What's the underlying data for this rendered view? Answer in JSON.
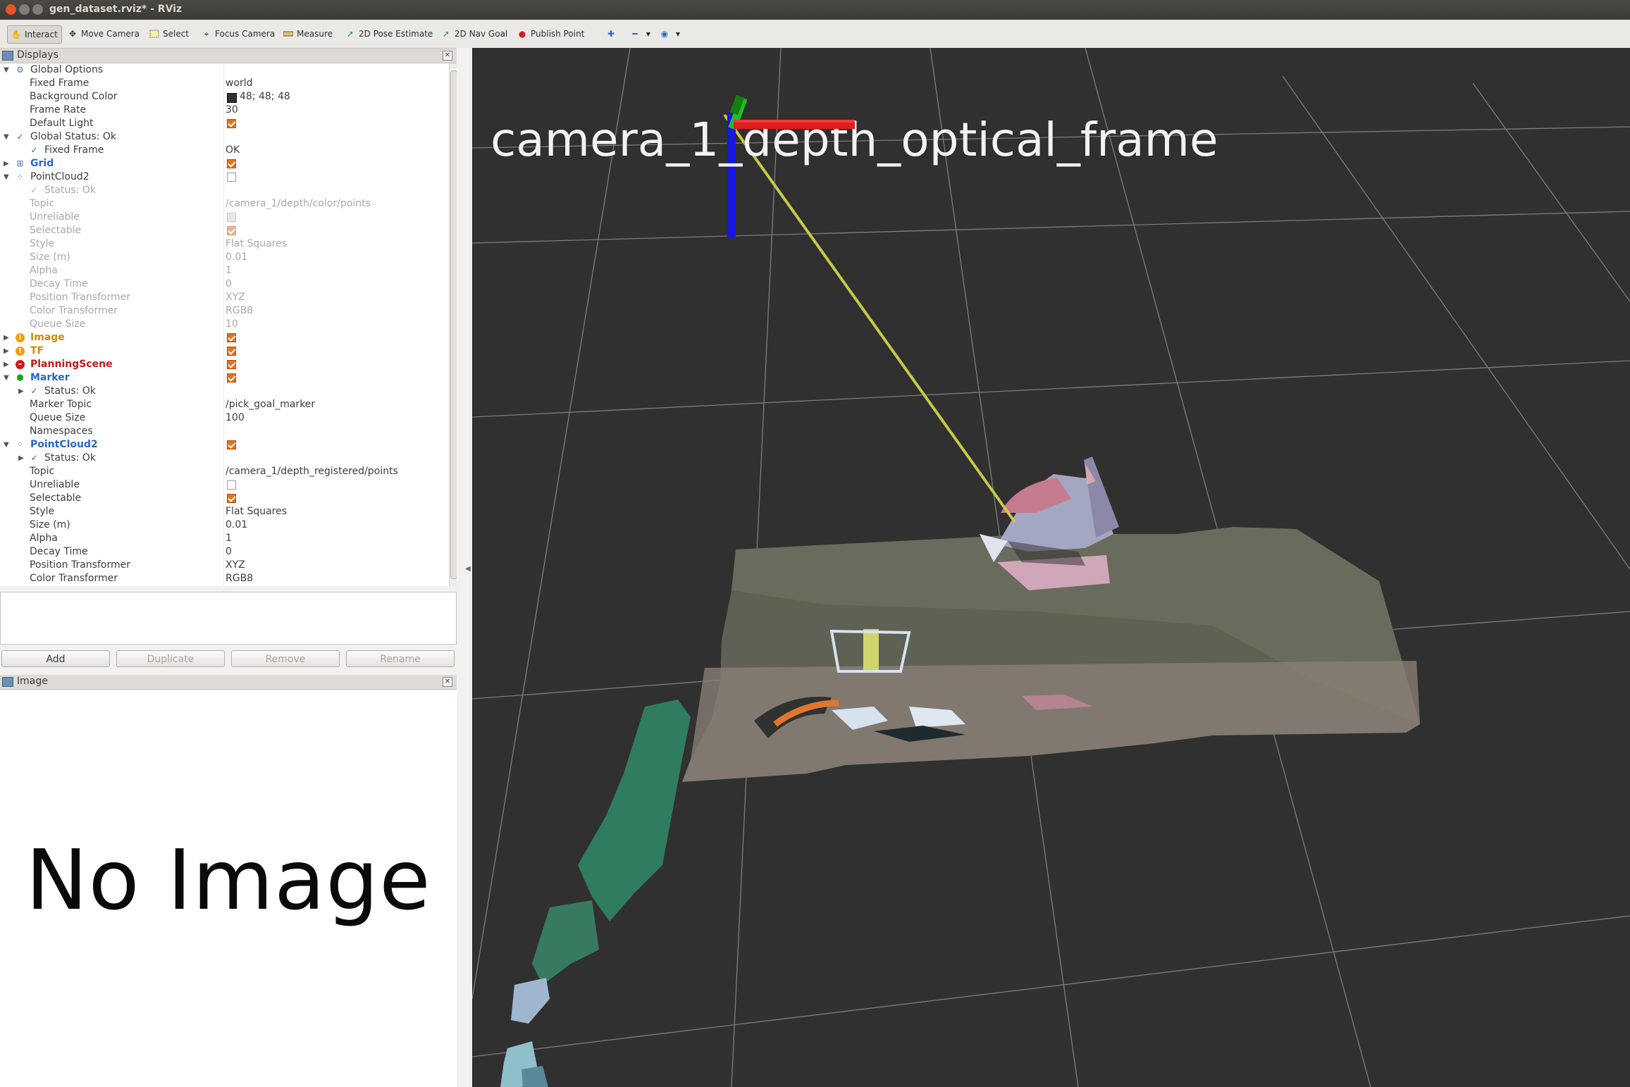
{
  "window": {
    "title": "gen_dataset.rviz* - RViz"
  },
  "toolbar": {
    "tools": [
      {
        "label": "Interact",
        "icon": "hand-icon"
      },
      {
        "label": "Move Camera",
        "icon": "move-camera-icon"
      },
      {
        "label": "Select",
        "icon": "select-icon"
      },
      {
        "label": "Focus Camera",
        "icon": "focus-camera-icon"
      },
      {
        "label": "Measure",
        "icon": "ruler-icon"
      },
      {
        "label": "2D Pose Estimate",
        "icon": "pose-arrow-icon"
      },
      {
        "label": "2D Nav Goal",
        "icon": "nav-goal-arrow-icon"
      },
      {
        "label": "Publish Point",
        "icon": "map-pin-icon"
      }
    ]
  },
  "displays_panel": {
    "title": "Displays",
    "rows": [
      {
        "name": "Global Options",
        "value": ""
      },
      {
        "name": "Fixed Frame",
        "value": "world"
      },
      {
        "name": "Background Color",
        "value": "48; 48; 48"
      },
      {
        "name": "Frame Rate",
        "value": "30"
      },
      {
        "name": "Default Light",
        "value": ""
      },
      {
        "name": "Global Status: Ok",
        "value": ""
      },
      {
        "name": "Fixed Frame",
        "value": "OK"
      },
      {
        "name": "Grid",
        "value": ""
      },
      {
        "name": "PointCloud2",
        "value": ""
      },
      {
        "name": "Status: Ok",
        "value": ""
      },
      {
        "name": "Topic",
        "value": "/camera_1/depth/color/points"
      },
      {
        "name": "Unreliable",
        "value": ""
      },
      {
        "name": "Selectable",
        "value": ""
      },
      {
        "name": "Style",
        "value": "Flat Squares"
      },
      {
        "name": "Size (m)",
        "value": "0.01"
      },
      {
        "name": "Alpha",
        "value": "1"
      },
      {
        "name": "Decay Time",
        "value": "0"
      },
      {
        "name": "Position Transformer",
        "value": "XYZ"
      },
      {
        "name": "Color Transformer",
        "value": "RGB8"
      },
      {
        "name": "Queue Size",
        "value": "10"
      },
      {
        "name": "Image",
        "value": ""
      },
      {
        "name": "TF",
        "value": ""
      },
      {
        "name": "PlanningScene",
        "value": ""
      },
      {
        "name": "Marker",
        "value": ""
      },
      {
        "name": "Status: Ok",
        "value": ""
      },
      {
        "name": "Marker Topic",
        "value": "/pick_goal_marker"
      },
      {
        "name": "Queue Size",
        "value": "100"
      },
      {
        "name": "Namespaces",
        "value": ""
      },
      {
        "name": "PointCloud2",
        "value": ""
      },
      {
        "name": "Status: Ok",
        "value": ""
      },
      {
        "name": "Topic",
        "value": "/camera_1/depth_registered/points"
      },
      {
        "name": "Unreliable",
        "value": ""
      },
      {
        "name": "Selectable",
        "value": ""
      },
      {
        "name": "Style",
        "value": "Flat Squares"
      },
      {
        "name": "Size (m)",
        "value": "0.01"
      },
      {
        "name": "Alpha",
        "value": "1"
      },
      {
        "name": "Decay Time",
        "value": "0"
      },
      {
        "name": "Position Transformer",
        "value": "XYZ"
      },
      {
        "name": "Color Transformer",
        "value": "RGB8"
      }
    ],
    "buttons": {
      "add": "Add",
      "duplicate": "Duplicate",
      "remove": "Remove",
      "rename": "Rename"
    }
  },
  "image_panel": {
    "title": "Image",
    "placeholder": "No Image"
  },
  "viewport": {
    "frame_label": "camera_1_depth_optical_frame"
  },
  "colors": {
    "background": "#303030",
    "grid": "#8a8a8a",
    "axis_x": "#e21b1b",
    "axis_y": "#1fbf1f",
    "axis_z": "#1717e0",
    "tf_link": "#c8c84a"
  }
}
